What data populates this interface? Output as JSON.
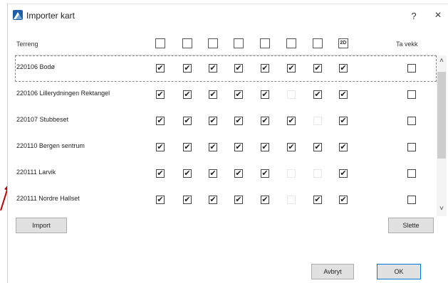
{
  "dialog": {
    "title": "Importer kart",
    "help_label": "?",
    "close_label": "×"
  },
  "table": {
    "terrain_header": "Terreng",
    "remove_header": "Ta vekk",
    "layer_icons": [
      "terrain-icon",
      "building-icon",
      "road-icon",
      "area-icon",
      "vegetation-icon",
      "water-icon",
      "landmark-icon",
      "2d-icon"
    ],
    "layer_icon_labels": [
      "",
      "",
      "",
      "",
      "",
      "",
      "",
      "2D"
    ],
    "rows": [
      {
        "name": "220106 Bodø",
        "layers": [
          true,
          true,
          true,
          true,
          true,
          true,
          true,
          true
        ],
        "remove": false,
        "selected": true
      },
      {
        "name": "220106 Lillerydningen Rektangel",
        "layers": [
          true,
          true,
          true,
          true,
          true,
          false,
          true,
          true
        ],
        "remove": false,
        "selected": false
      },
      {
        "name": "220107 Stubbeset",
        "layers": [
          true,
          true,
          true,
          true,
          true,
          true,
          false,
          true
        ],
        "remove": false,
        "selected": false
      },
      {
        "name": "220110 Bergen sentrum",
        "layers": [
          true,
          true,
          true,
          true,
          true,
          true,
          true,
          true
        ],
        "remove": false,
        "selected": false
      },
      {
        "name": "220111 Larvik",
        "layers": [
          true,
          true,
          true,
          true,
          true,
          false,
          false,
          true
        ],
        "remove": false,
        "selected": false
      },
      {
        "name": "220111 Nordre Hallset",
        "layers": [
          true,
          true,
          true,
          true,
          true,
          false,
          true,
          true
        ],
        "remove": false,
        "selected": false
      }
    ]
  },
  "buttons": {
    "import": "Import",
    "delete": "Slette",
    "cancel": "Avbryt",
    "ok": "OK"
  },
  "colors": {
    "accent": "#0078d7",
    "arrow": "#c00000"
  }
}
